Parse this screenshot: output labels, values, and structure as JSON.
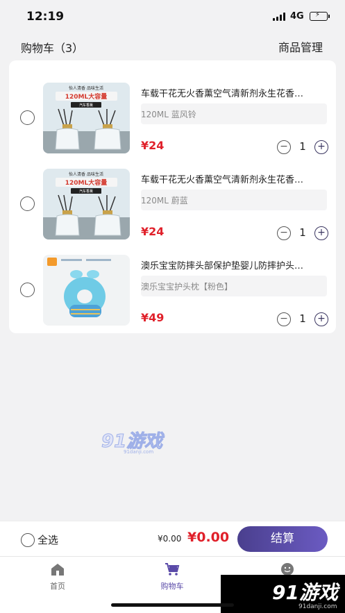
{
  "status_bar": {
    "time": "12:19",
    "network": "4G"
  },
  "header": {
    "title": "购物车（3）",
    "manage": "商品管理"
  },
  "items": [
    {
      "name": "车载干花无火香薰空气清新剂永生花香…",
      "spec": "120ML  蓝风铃",
      "price": "¥24",
      "qty": "1",
      "thumb_banner": "120ML大容量",
      "thumb_top": "怡人清香 品味生活",
      "thumb_tag": "汽车香薰"
    },
    {
      "name": "车载干花无火香薰空气清新剂永生花香…",
      "spec": "120ML  蔚蓝",
      "price": "¥24",
      "qty": "1",
      "thumb_banner": "120ML大容量",
      "thumb_top": "怡人清香 品味生活",
      "thumb_tag": "汽车香薰"
    },
    {
      "name": "澳乐宝宝防摔头部保护垫婴儿防摔护头…",
      "spec": "澳乐宝宝护头枕【粉色】",
      "price": "¥49",
      "qty": "1",
      "thumb_banner": "",
      "thumb_top": "",
      "thumb_tag": ""
    }
  ],
  "stepper": {
    "minus": "−",
    "plus": "+"
  },
  "watermark": {
    "text": "91游戏",
    "sub": "91danji.com"
  },
  "action_bar": {
    "select_all": "全选",
    "total_small": "¥0.00",
    "total_big": "¥0.00",
    "checkout": "结算"
  },
  "tabbar": {
    "tabs": [
      {
        "label": "首页",
        "icon": "home-icon"
      },
      {
        "label": "购物车",
        "icon": "cart-icon"
      },
      {
        "label": "",
        "icon": "smiley-icon"
      }
    ]
  },
  "logo": {
    "text": "91游戏",
    "sub": "91danji.com"
  },
  "colors": {
    "price": "#e0202a",
    "accent": "#5a4aa8",
    "checkout_start": "#4a3f8e",
    "checkout_end": "#6b5bc2"
  }
}
